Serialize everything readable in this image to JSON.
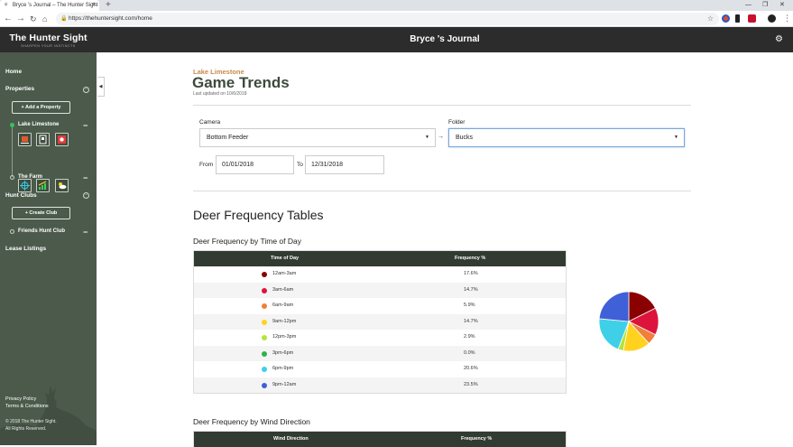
{
  "browser": {
    "tab_title": "Bryce 's Journal – The Hunter Sight",
    "new_tab": "+",
    "url": "https://thehuntersight.com/home",
    "win_min": "—",
    "win_max": "❐",
    "win_close": "✕"
  },
  "sidebar": {
    "logo": "The Hunter Sight",
    "tagline": "SHARPEN YOUR INSTINCTS",
    "home": "Home",
    "properties": "Properties",
    "add_property": "+ Add a Property",
    "property_1": "Lake Limestone",
    "property_2": "The Farm",
    "hunt_clubs": "Hunt Clubs",
    "create_club": "+ Create Club",
    "club_1": "Friends Hunt Club",
    "lease_listings": "Lease Listings",
    "privacy": "Privacy Policy",
    "terms": "Terms & Conditions",
    "copyright_1": "© 2018 The Hunter Sight.",
    "copyright_2": "All Rights Reserved."
  },
  "header": {
    "title": "Bryce 's Journal"
  },
  "page": {
    "subtitle": "Lake Limestone",
    "title": "Game Trends",
    "updated": "Last updated on 10/6/2018",
    "camera_label": "Camera",
    "camera_value": "Bottom Feeder",
    "folder_label": "Folder",
    "folder_value": "Bucks",
    "arrow": "→",
    "from_label": "From",
    "from_value": "01/01/2018",
    "to_label": "To",
    "to_value": "12/31/2018",
    "section_title": "Deer Frequency Tables",
    "table1_title": "Deer Frequency by Time of Day",
    "table1_col1": "Time of Day",
    "table1_col2": "Frequency %",
    "table2_title": "Deer Frequency by Wind Direction",
    "table2_col1": "Wind Direction",
    "table2_col2": "Frequency %"
  },
  "colors": {
    "sidebar_bg": "#4b5a4b",
    "header_bg": "#2c2c2c",
    "accent_orange": "#c98a4b",
    "title_green": "#3c4a3c"
  },
  "chart_data": {
    "type": "pie",
    "categories": [
      "12am-3am",
      "3am-6am",
      "6am-9am",
      "9am-12pm",
      "12pm-3pm",
      "3pm-6pm",
      "6pm-9pm",
      "9pm-12am"
    ],
    "values": [
      "17.6%",
      "14.7%",
      "5.9%",
      "14.7%",
      "2.9%",
      "0.0%",
      "20.6%",
      "23.5%"
    ],
    "colors": [
      "#8b0000",
      "#dc143c",
      "#f07f3a",
      "#ffd21f",
      "#b5e33a",
      "#2fb34a",
      "#3fd0e8",
      "#4060d8"
    ]
  }
}
